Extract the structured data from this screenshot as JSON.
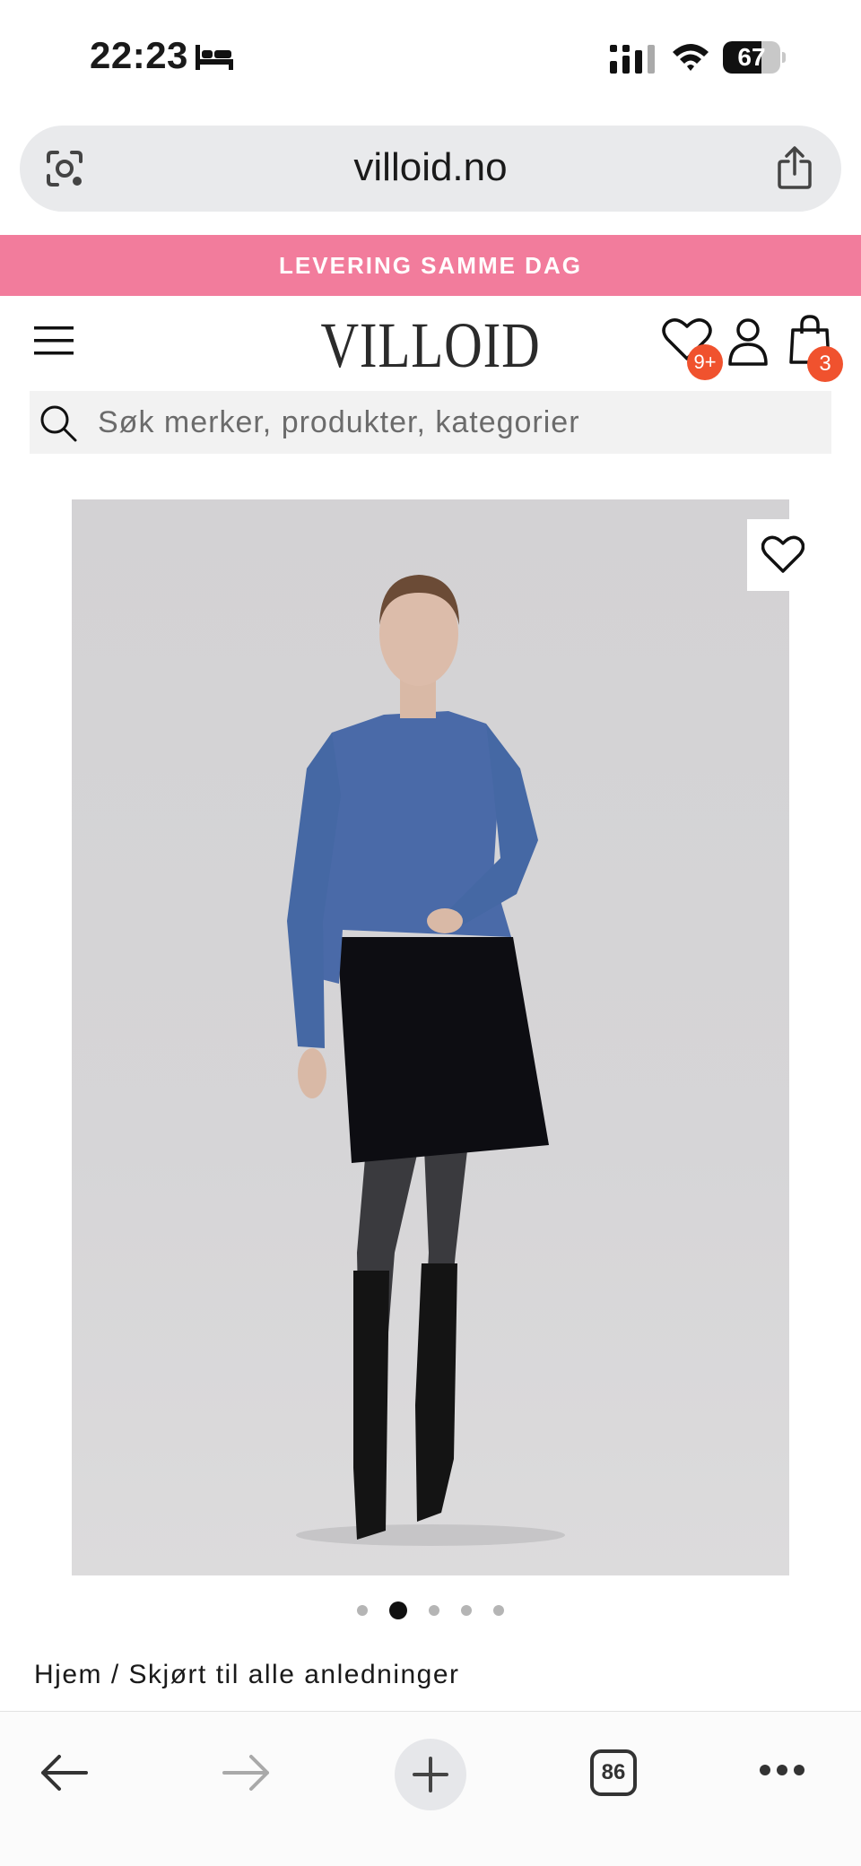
{
  "status_bar": {
    "time": "22:23",
    "battery": "67",
    "battery_level": 0.67,
    "icons": [
      "bed-icon",
      "cellular-signal-icon",
      "wifi-icon",
      "battery-icon"
    ]
  },
  "browser": {
    "url": "villoid.no",
    "icons": [
      "scan-icon",
      "share-icon"
    ]
  },
  "promo": {
    "text": "LEVERING SAMME DAG"
  },
  "header": {
    "logo": "VILLOID",
    "wishlist_badge": "9+",
    "cart_badge": "3",
    "icons": [
      "menu-icon",
      "heart-icon",
      "user-icon",
      "shopping-bag-icon"
    ]
  },
  "search": {
    "placeholder": "Søk merker, produkter, kategorier"
  },
  "product": {
    "image_icon": "favorite-heart-icon",
    "carousel_count": 5,
    "carousel_active_index": 1
  },
  "breadcrumb": {
    "home": "Hjem",
    "separator": " / ",
    "category": "Skjørt til alle anledninger"
  },
  "bottom_bar": {
    "tab_count": "86",
    "icons": [
      "back-arrow-icon",
      "forward-arrow-icon",
      "plus-icon",
      "tabs-icon",
      "more-icon"
    ]
  },
  "colors": {
    "promo_bg": "#f27c9c",
    "badge": "#f0522e",
    "sweater": "#4a6aa8"
  }
}
